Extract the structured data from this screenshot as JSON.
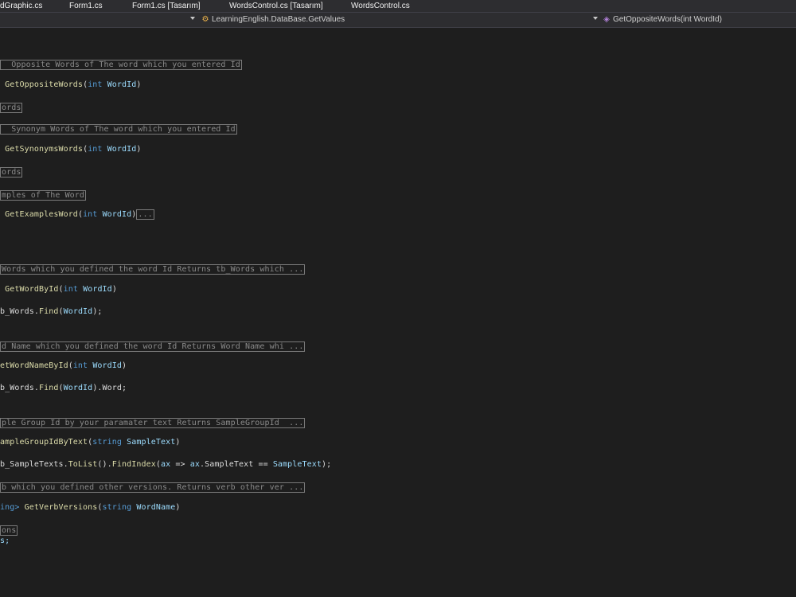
{
  "tabs": [
    "dGraphic.cs",
    "Form1.cs",
    "Form1.cs [Tasarım]",
    "WordsControl.cs [Tasarım]",
    "WordsControl.cs"
  ],
  "nav": {
    "class_path": "LearningEnglish.DataBase.GetValues",
    "member": "GetOppositeWords(int WordId)"
  },
  "code": {
    "c1": "Opposite Words of The word which you entered Id",
    "l1_fn": "GetOppositeWords",
    "l1_kw": "int",
    "l1_id": "WordId",
    "c2": "ords",
    "c3": "Synonym Words of The word which you entered Id",
    "l2_fn": "GetSynonymsWords",
    "l2_kw": "int",
    "l2_id": "WordId",
    "c4": "ords",
    "c5": "mples of The Word",
    "l3_fn": "GetExamplesWord",
    "l3_kw": "int",
    "l3_id": "WordId",
    "l3_collapsed": "...",
    "c6": "Words which you defined the word Id Returns tb_Words which ...",
    "l4_fn": "GetWordById",
    "l4_kw": "int",
    "l4_id": "WordId",
    "l5_a": "b_Words.",
    "l5_fn": "Find",
    "l5_id": "WordId",
    "l5_end": ");",
    "c7": "d Name which you defined the word Id Returns Word Name whi ...",
    "l6_fn": "etWordNameById",
    "l6_kw": "int",
    "l6_id": "WordId",
    "l7_a": "b_Words.",
    "l7_fn": "Find",
    "l7_id": "WordId",
    "l7_end": ").Word;",
    "c8": "ple Group Id by your paramater text Returns SampleGroupId  ...",
    "l8_fn": "ampleGroupIdByText",
    "l8_kw": "string",
    "l8_id": "SampleText",
    "l9_a": "b_SampleTexts.",
    "l9_fn1": "ToList",
    "l9_mid": "().",
    "l9_fn2": "FindIndex",
    "l9_id1": "ax",
    "l9_arrow": " => ",
    "l9_id2": "ax",
    "l9_prop": ".SampleText == ",
    "l9_id3": "SampleText",
    "l9_end": ");",
    "c9": "b which you defined other versions. Returns verb other ver ...",
    "l10_a": "ing>",
    "l10_fn": "GetVerbVersions",
    "l10_kw": "string",
    "l10_id": "WordName",
    "c10": "ons",
    "l11": "s;"
  }
}
